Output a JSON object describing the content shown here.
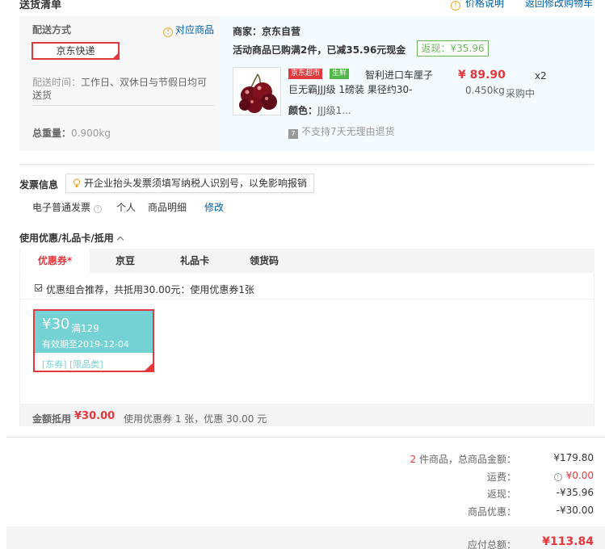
{
  "header": {
    "title": "送货清单",
    "price_explain": "价格说明",
    "back_to_cart": "返回修改购物车"
  },
  "shipping": {
    "method_title": "配送方式",
    "related_goods": "对应商品",
    "express": "京东快递",
    "delivery_label": "配送时间：",
    "delivery_value": "工作日、双休日与节假日均可送货",
    "weight_label": "总重量：",
    "weight_value": "0.900kg"
  },
  "merchant": {
    "label": "商家：京东自营",
    "promo": "活动商品已购满2件，已减35.96元现金",
    "rebate_badge": "返现：¥35.96"
  },
  "product": {
    "tag_jd": "京东超市",
    "tag_fresh": "生鲜",
    "name": "智利进口车厘子 巨无霸JJJ级 1磅装 果径约30-",
    "price": "¥ 89.90",
    "qty": "x2",
    "weight": "0.450kg",
    "status": "采购中",
    "color_label": "颜色：",
    "color_value": "JJJ级1...",
    "no_return": "不支持7天无理由退货"
  },
  "invoice": {
    "title": "发票信息",
    "tip": "开企业抬头发票须填写纳税人识别号，以免影响报销",
    "type": "电子普通发票",
    "personal": "个人",
    "detail": "商品明细",
    "edit": "修改"
  },
  "coupons": {
    "title": "使用优惠/礼品卡/抵用",
    "tabs": [
      "优惠券*",
      "京豆",
      "礼品卡",
      "领货码"
    ],
    "combo_text": "优惠组合推荐，共抵用30.00元：使用优惠券1张",
    "card": {
      "amount": "¥30",
      "condition": "满129",
      "valid": "有效期至2019-12-04",
      "tags": "[东券] [限品类]"
    },
    "deduct_label": "金额抵用",
    "deduct_value": "¥30.00",
    "deduct_desc": "使用优惠券 1 张，优惠 30.00 元"
  },
  "summary": {
    "items_count": "2",
    "items_label": " 件商品，总商品金额：",
    "items_value": "¥179.80",
    "shipping_label": "运费：",
    "shipping_value": "¥0.00",
    "rebate_label": "返现：",
    "rebate_value": "-¥35.96",
    "discount_label": "商品优惠：",
    "discount_value": "-¥30.00",
    "total_label": "应付总额：",
    "total_value": "¥113.84"
  },
  "colors": {
    "accent_red": "#e4393c",
    "link_blue": "#005ea7",
    "coupon_teal": "#74d2d4",
    "rebate_green": "#6cb55f"
  }
}
